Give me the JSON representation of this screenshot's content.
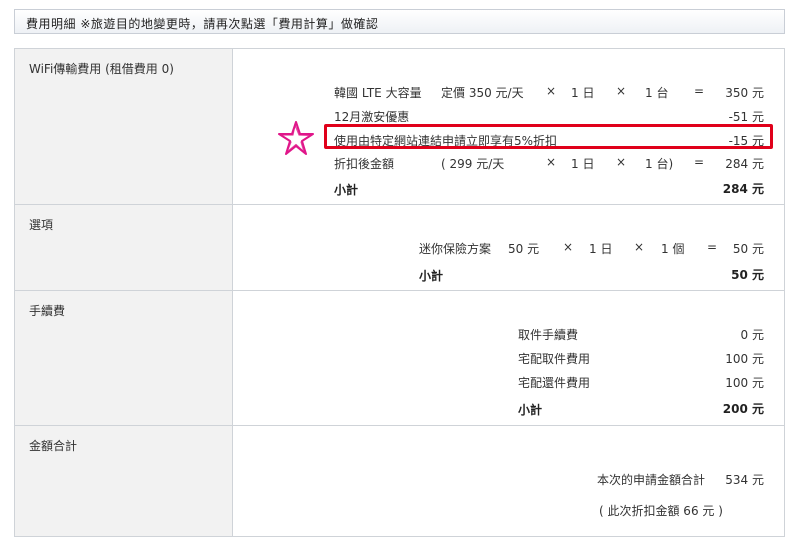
{
  "header": {
    "text": "費用明細 ※旅遊目的地變更時，請再次點選「費用計算」做確認"
  },
  "wifi": {
    "label": "WiFi傳輸費用 (租借費用 0)",
    "row1": {
      "name": "韓國 LTE 大容量",
      "price": "定價 350 元/天",
      "x1": "×",
      "days": "1 日",
      "x2": "×",
      "units": "1 台",
      "eq": "=",
      "amount": "350 元"
    },
    "row2": {
      "name": "12月激安優惠",
      "amount": "-51 元"
    },
    "row3": {
      "name": "使用由特定網站連結申請立即享有5%折扣",
      "amount": "-15 元"
    },
    "row4": {
      "name": "折扣後金額",
      "price": "( 299 元/天",
      "x1": "×",
      "days": "1 日",
      "x2": "×",
      "units": "1 台)",
      "eq": "=",
      "amount": "284 元"
    },
    "subtotal_label": "小計",
    "subtotal": "284 元"
  },
  "options": {
    "label": "選項",
    "row1": {
      "name": "迷你保險方案",
      "price": "50 元",
      "x1": "×",
      "days": "1 日",
      "x2": "×",
      "units": "1 個",
      "eq": "=",
      "amount": "50 元"
    },
    "subtotal_label": "小計",
    "subtotal": "50 元"
  },
  "fees": {
    "label": "手續費",
    "row1": {
      "name": "取件手續費",
      "amount": "0 元"
    },
    "row2": {
      "name": "宅配取件費用",
      "amount": "100 元"
    },
    "row3": {
      "name": "宅配還件費用",
      "amount": "100 元"
    },
    "subtotal_label": "小計",
    "subtotal": "200 元"
  },
  "total": {
    "label": "金額合計",
    "name": "本次的申請金額合計",
    "amount": "534 元",
    "discount_note": "( 此次折扣金額 66 元 )"
  },
  "colors": {
    "highlight": "#e0001a",
    "star": "#e0168a"
  }
}
